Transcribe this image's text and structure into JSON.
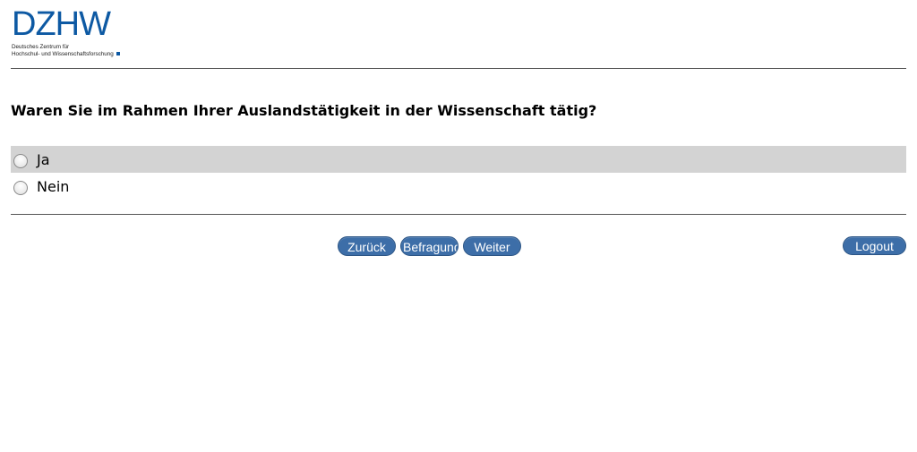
{
  "logo": {
    "mark": "DZHW",
    "line1": "Deutsches Zentrum für",
    "line2": "Hochschul- und Wissenschaftsforschung",
    "color": "#0d59a3"
  },
  "question": {
    "text": "Waren Sie im Rahmen Ihrer Auslandstätigkeit in der Wissenschaft tätig?"
  },
  "options": [
    {
      "label": "Ja",
      "selected": false,
      "highlighted": true
    },
    {
      "label": "Nein",
      "selected": false,
      "highlighted": false
    }
  ],
  "navigation": {
    "back_label": "Zurück",
    "survey_label": "Befragung",
    "next_label": "Weiter",
    "logout_label": "Logout"
  },
  "colors": {
    "button": "#3d6ea8",
    "highlight_row": "#d3d3d3"
  }
}
